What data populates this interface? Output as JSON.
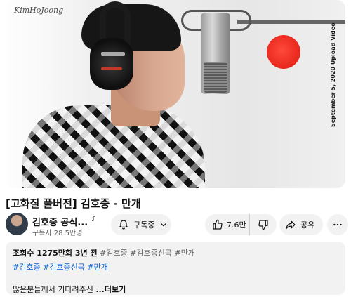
{
  "video": {
    "watermark": "KimHoJoong",
    "side_caption": "September 5, 2020 Upload Video"
  },
  "title": "[고화질 풀버전] 김호중 - 만개",
  "channel": {
    "name": "김호중 공식...",
    "subscribers": "구독자 28.5만명",
    "subscribe_label": "구독중"
  },
  "actions": {
    "likes": "7.6만",
    "share_label": "공유"
  },
  "description": {
    "stats": "조회수 1275만회  3년 전",
    "tags_line1": "#김호중 #김호중신곡 #만개",
    "tags_line2": "#김호중 #김호중신곡 #만개",
    "snippet": "많은분들께서 기다려주신 ",
    "more_label": "...더보기"
  },
  "icons": [
    "bell-icon",
    "chevron-down-icon",
    "thumb-up-icon",
    "thumb-down-icon",
    "share-icon",
    "more-vert-icon",
    "music-note-icon"
  ],
  "colors": {
    "link_blue": "#065fd4",
    "pill_bg": "#f2f2f2",
    "record_light": "#e8261c"
  }
}
